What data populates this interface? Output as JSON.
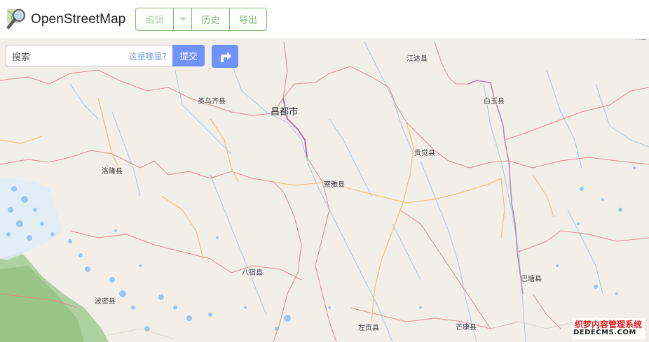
{
  "header": {
    "brand": "OpenStreetMap",
    "edit_label": "编辑",
    "history_label": "历史",
    "export_label": "导出"
  },
  "search": {
    "placeholder": "搜索",
    "where_link": "这是哪里?",
    "submit_label": "提交"
  },
  "map": {
    "places": {
      "changdu": "昌都市",
      "jiangda": "江达县",
      "leiwuqi": "类乌齐县",
      "baiyu": "白玉县",
      "gongjue": "贡觉县",
      "luolong": "洛隆县",
      "chaya": "察雅县",
      "basu": "八宿县",
      "batang": "巴塘县",
      "bomi": "波密县",
      "zuogong": "左贡县",
      "mangkang": "芒康县"
    },
    "corner_text": "白玉"
  },
  "watermark": {
    "line1": "织梦内容管理系统",
    "line2": "DEDECMS.COM"
  },
  "colors": {
    "osm_green": "#7ebc6f",
    "search_blue": "#7092ff",
    "map_land": "#f2efe9",
    "river": "#a0c8f0",
    "admin_border": "#b783b8",
    "road_red": "#e08a8a",
    "road_orange": "#f3c27e"
  }
}
